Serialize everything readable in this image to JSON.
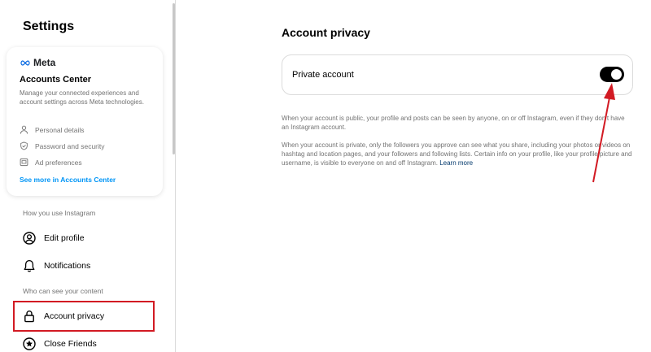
{
  "sidebar": {
    "title": "Settings",
    "accounts_center": {
      "brand": "Meta",
      "title": "Accounts Center",
      "description": "Manage your connected experiences and account settings across Meta technologies.",
      "items": [
        {
          "label": "Personal details",
          "icon": "person-icon"
        },
        {
          "label": "Password and security",
          "icon": "shield-check-icon"
        },
        {
          "label": "Ad preferences",
          "icon": "ad-preferences-icon"
        }
      ],
      "link": "See more in Accounts Center"
    },
    "section_usage": "How you use Instagram",
    "nav_edit_profile": "Edit profile",
    "nav_notifications": "Notifications",
    "section_visibility": "Who can see your content",
    "nav_account_privacy": "Account privacy",
    "nav_close_friends": "Close Friends"
  },
  "main": {
    "title": "Account privacy",
    "private_account_label": "Private account",
    "private_account_enabled": true,
    "para_public": "When your account is public, your profile and posts can be seen by anyone, on or off Instagram, even if they don't have an Instagram account.",
    "para_private": "When your account is private, only the followers you approve can see what you share, including your photos or videos on hashtag and location pages, and your followers and following lists. Certain info on your profile, like your profile picture and username, is visible to everyone on and off Instagram.",
    "learn_more": "Learn more"
  },
  "colors": {
    "annotation_red": "#d21a23",
    "link_blue": "#0095f6",
    "toggle_on": "#000000"
  }
}
